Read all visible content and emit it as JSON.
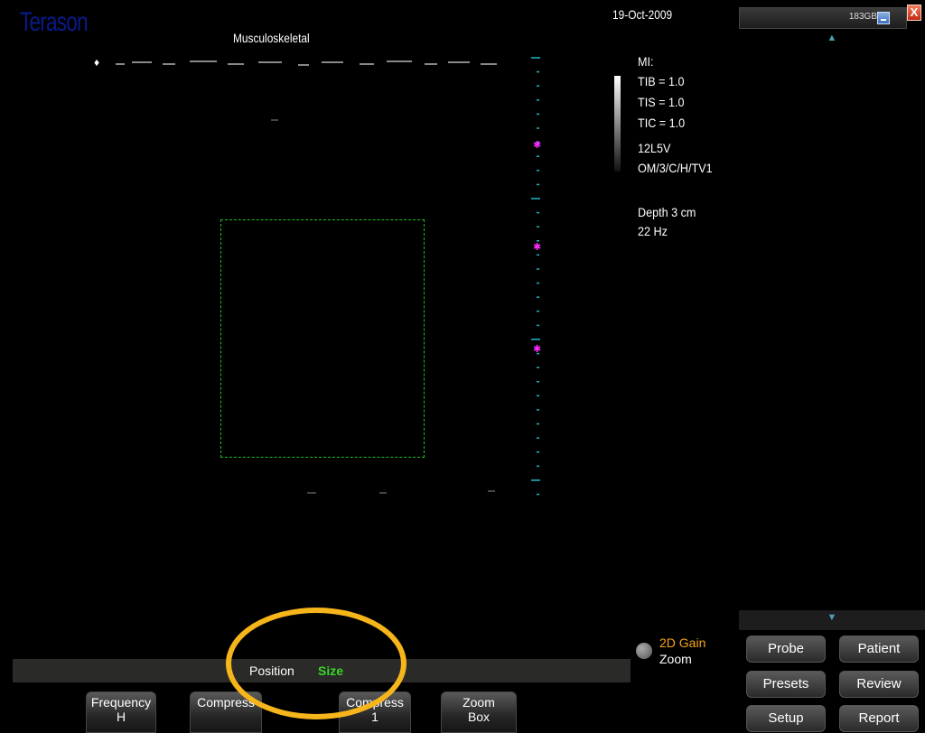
{
  "header": {
    "brand": "Terason",
    "preset": "Musculoskeletal",
    "date": "19-Oct-2009",
    "storage": "183GB",
    "close_glyph": "X"
  },
  "icons": {
    "scroll_up": "▲",
    "scroll_down": "▼",
    "focal_marker": "♦"
  },
  "info": {
    "mi": "MI:",
    "tib": "TIB = 1.0",
    "tis": "TIS = 1.0",
    "tic": "TIC = 1.0",
    "probe": "12L5V",
    "mode": "OM/3/C/H/TV1",
    "depth": "Depth 3 cm",
    "rate": "22 Hz"
  },
  "knob": {
    "primary": "2D Gain",
    "secondary": "Zoom"
  },
  "position_bar": {
    "position": "Position",
    "size": "Size"
  },
  "softkeys": [
    {
      "label": "Frequency",
      "value": "H"
    },
    {
      "label": "Compress",
      "value": ""
    },
    {
      "label": "Compress",
      "value": "1"
    },
    {
      "label": "Zoom",
      "value": "Box"
    }
  ],
  "side_buttons": {
    "probe": "Probe",
    "patient": "Patient",
    "presets": "Presets",
    "review": "Review",
    "setup": "Setup",
    "report": "Report"
  },
  "colors": {
    "accent_gain": "#f6a51a",
    "size_active": "#39d52b",
    "zoom_box": "#20c020",
    "focal_markers": "#ff2bff",
    "highlight": "#f6b51a"
  }
}
